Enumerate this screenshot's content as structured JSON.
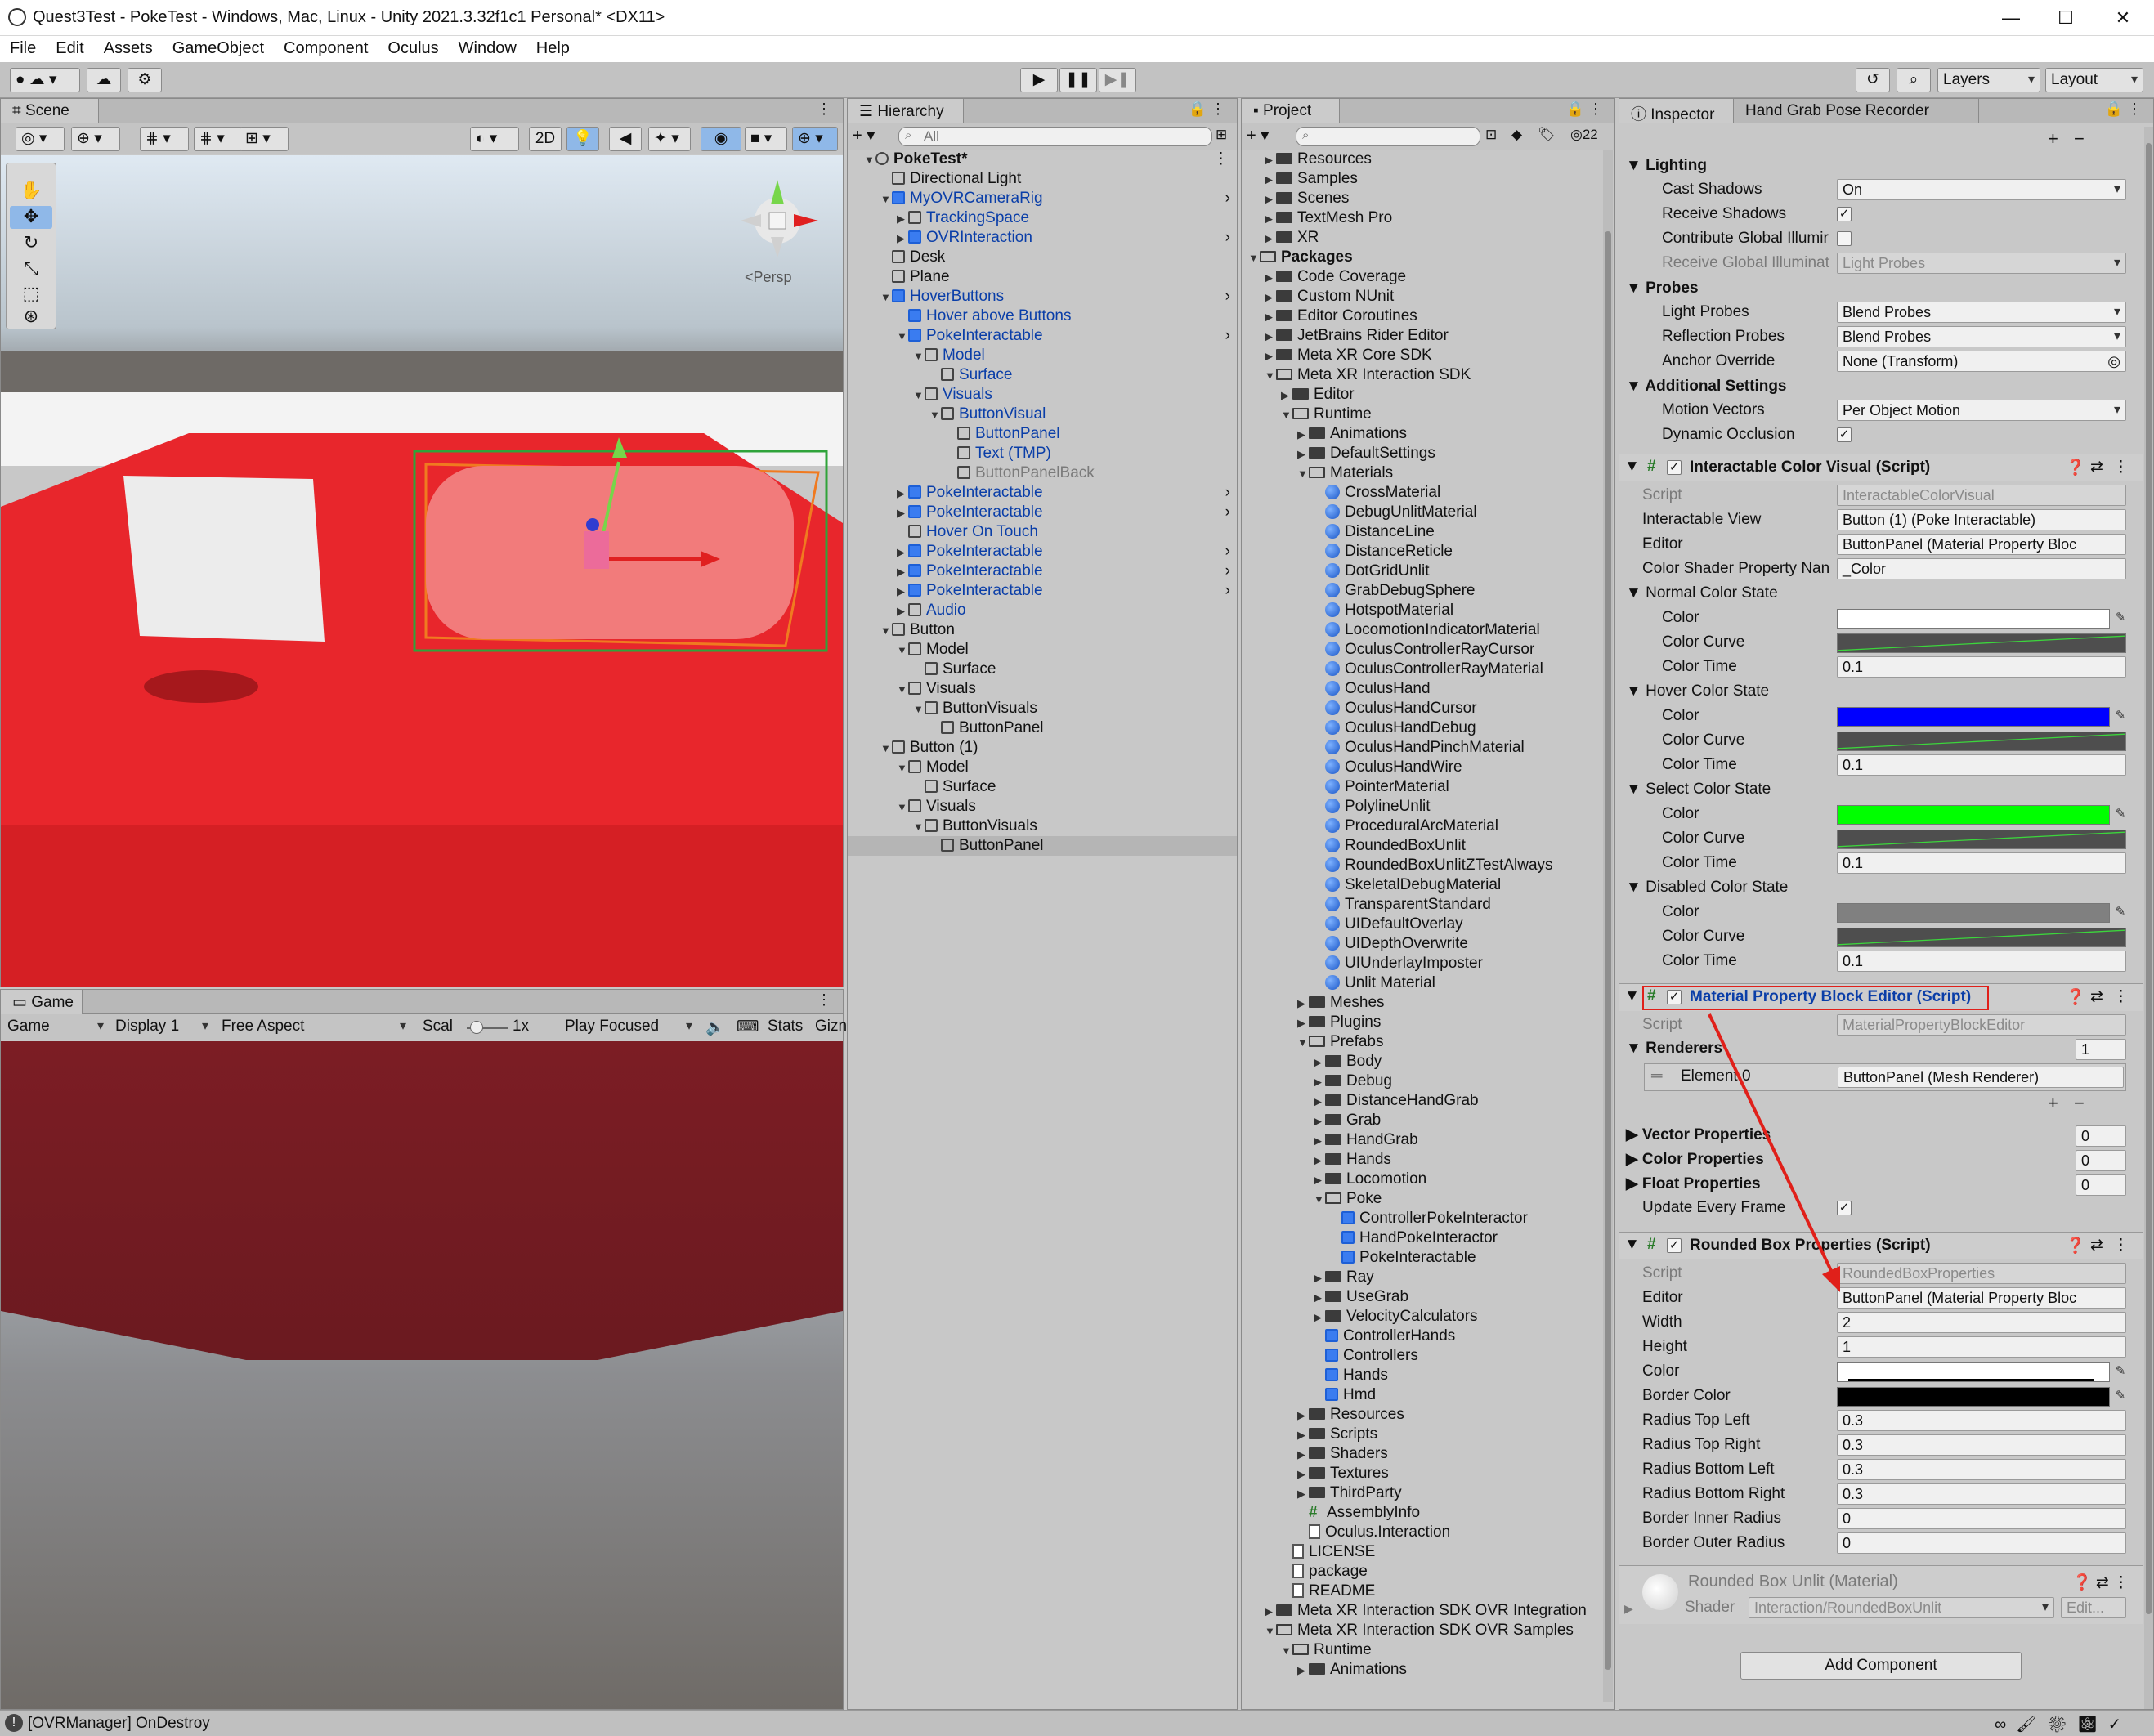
{
  "window": {
    "title": "Quest3Test - PokeTest - Windows, Mac, Linux - Unity 2021.3.32f1c1 Personal* <DX11>",
    "controls": {
      "minimize": "—",
      "maximize": "☐",
      "close": "✕"
    }
  },
  "menu": [
    "File",
    "Edit",
    "Assets",
    "GameObject",
    "Component",
    "Oculus",
    "Window",
    "Help"
  ],
  "toolbar": {
    "play": "▶",
    "pause": "❚❚",
    "step": "▶❚",
    "layers_label": "Layers",
    "layout_label": "Layout"
  },
  "scene": {
    "tab_label": "Scene",
    "persp_label": "<Persp",
    "mode_2d": "2D"
  },
  "game": {
    "tab_label": "Game",
    "display_select": "Game",
    "display": "Display 1",
    "aspect": "Free Aspect",
    "scale_label": "Scal",
    "scale_value": "1x",
    "play_focused": "Play Focused",
    "stats": "Stats",
    "gizmos": "Gizn"
  },
  "hierarchy": {
    "tab_label": "Hierarchy",
    "search_placeholder": "All",
    "items": [
      {
        "label": "PokeTest*",
        "depth": 0,
        "kind": "scene",
        "bold": true,
        "open": true
      },
      {
        "label": "Directional Light",
        "depth": 1,
        "kind": "cube"
      },
      {
        "label": "MyOVRCameraRig",
        "depth": 1,
        "kind": "cubeb",
        "blue": true,
        "open": true,
        "arrow": true
      },
      {
        "label": "TrackingSpace",
        "depth": 2,
        "kind": "cube",
        "blue": true,
        "closed": true
      },
      {
        "label": "OVRInteraction",
        "depth": 2,
        "kind": "cubeb",
        "blue": true,
        "closed": true,
        "arrow": true
      },
      {
        "label": "Desk",
        "depth": 1,
        "kind": "cube"
      },
      {
        "label": "Plane",
        "depth": 1,
        "kind": "cube"
      },
      {
        "label": "HoverButtons",
        "depth": 1,
        "kind": "cubeb",
        "blue": true,
        "open": true,
        "arrow": true
      },
      {
        "label": "Hover above Buttons",
        "depth": 2,
        "kind": "cubeb",
        "blue": true
      },
      {
        "label": "PokeInteractable",
        "depth": 2,
        "kind": "cubeb",
        "blue": true,
        "open": true,
        "arrow": true
      },
      {
        "label": "Model",
        "depth": 3,
        "kind": "cube",
        "blue": true,
        "open": true
      },
      {
        "label": "Surface",
        "depth": 4,
        "kind": "cube",
        "blue": true
      },
      {
        "label": "Visuals",
        "depth": 3,
        "kind": "cube",
        "blue": true,
        "open": true
      },
      {
        "label": "ButtonVisual",
        "depth": 4,
        "kind": "cube",
        "blue": true,
        "open": true
      },
      {
        "label": "ButtonPanel",
        "depth": 5,
        "kind": "cube",
        "blue": true
      },
      {
        "label": "Text (TMP)",
        "depth": 5,
        "kind": "cube",
        "blue": true
      },
      {
        "label": "ButtonPanelBack",
        "depth": 5,
        "kind": "cube",
        "gray": true
      },
      {
        "label": "PokeInteractable",
        "depth": 2,
        "kind": "cubeb",
        "blue": true,
        "closed": true,
        "arrow": true
      },
      {
        "label": "PokeInteractable",
        "depth": 2,
        "kind": "cubeb",
        "blue": true,
        "closed": true,
        "arrow": true
      },
      {
        "label": "Hover On Touch",
        "depth": 2,
        "kind": "cube",
        "blue": true
      },
      {
        "label": "PokeInteractable",
        "depth": 2,
        "kind": "cubeb",
        "blue": true,
        "closed": true,
        "arrow": true
      },
      {
        "label": "PokeInteractable",
        "depth": 2,
        "kind": "cubeb",
        "blue": true,
        "closed": true,
        "arrow": true
      },
      {
        "label": "PokeInteractable",
        "depth": 2,
        "kind": "cubeb",
        "blue": true,
        "closed": true,
        "arrow": true
      },
      {
        "label": "Audio",
        "depth": 2,
        "kind": "cube",
        "blue": true,
        "closed": true
      },
      {
        "label": "Button",
        "depth": 1,
        "kind": "cube",
        "open": true
      },
      {
        "label": "Model",
        "depth": 2,
        "kind": "cube",
        "open": true
      },
      {
        "label": "Surface",
        "depth": 3,
        "kind": "cube"
      },
      {
        "label": "Visuals",
        "depth": 2,
        "kind": "cube",
        "open": true
      },
      {
        "label": "ButtonVisuals",
        "depth": 3,
        "kind": "cube",
        "open": true
      },
      {
        "label": "ButtonPanel",
        "depth": 4,
        "kind": "cube"
      },
      {
        "label": "Button (1)",
        "depth": 1,
        "kind": "cube",
        "open": true
      },
      {
        "label": "Model",
        "depth": 2,
        "kind": "cube",
        "open": true
      },
      {
        "label": "Surface",
        "depth": 3,
        "kind": "cube"
      },
      {
        "label": "Visuals",
        "depth": 2,
        "kind": "cube",
        "open": true
      },
      {
        "label": "ButtonVisuals",
        "depth": 3,
        "kind": "cube",
        "open": true
      },
      {
        "label": "ButtonPanel",
        "depth": 4,
        "kind": "cube",
        "selected": true
      }
    ]
  },
  "project": {
    "tab_label": "Project",
    "hidden_count": "22",
    "items": [
      {
        "label": "Resources",
        "depth": 1,
        "kind": "folder",
        "closed": true
      },
      {
        "label": "Samples",
        "depth": 1,
        "kind": "folder",
        "closed": true
      },
      {
        "label": "Scenes",
        "depth": 1,
        "kind": "folder",
        "closed": true
      },
      {
        "label": "TextMesh Pro",
        "depth": 1,
        "kind": "folder",
        "closed": true
      },
      {
        "label": "XR",
        "depth": 1,
        "kind": "folder",
        "closed": true
      },
      {
        "label": "Packages",
        "depth": 0,
        "kind": "folderopen",
        "open": true,
        "bold": true
      },
      {
        "label": "Code Coverage",
        "depth": 1,
        "kind": "folder",
        "closed": true
      },
      {
        "label": "Custom NUnit",
        "depth": 1,
        "kind": "folder",
        "closed": true
      },
      {
        "label": "Editor Coroutines",
        "depth": 1,
        "kind": "folder",
        "closed": true
      },
      {
        "label": "JetBrains Rider Editor",
        "depth": 1,
        "kind": "folder",
        "closed": true
      },
      {
        "label": "Meta XR Core SDK",
        "depth": 1,
        "kind": "folder",
        "closed": true
      },
      {
        "label": "Meta XR Interaction SDK",
        "depth": 1,
        "kind": "folderopen",
        "open": true
      },
      {
        "label": "Editor",
        "depth": 2,
        "kind": "folder",
        "closed": true
      },
      {
        "label": "Runtime",
        "depth": 2,
        "kind": "folderopen",
        "open": true
      },
      {
        "label": "Animations",
        "depth": 3,
        "kind": "folder",
        "closed": true
      },
      {
        "label": "DefaultSettings",
        "depth": 3,
        "kind": "folder",
        "closed": true
      },
      {
        "label": "Materials",
        "depth": 3,
        "kind": "folderopen",
        "open": true
      },
      {
        "label": "CrossMaterial",
        "depth": 4,
        "kind": "ball"
      },
      {
        "label": "DebugUnlitMaterial",
        "depth": 4,
        "kind": "ball"
      },
      {
        "label": "DistanceLine",
        "depth": 4,
        "kind": "ball"
      },
      {
        "label": "DistanceReticle",
        "depth": 4,
        "kind": "ball"
      },
      {
        "label": "DotGridUnlit",
        "depth": 4,
        "kind": "ball"
      },
      {
        "label": "GrabDebugSphere",
        "depth": 4,
        "kind": "ball"
      },
      {
        "label": "HotspotMaterial",
        "depth": 4,
        "kind": "ball"
      },
      {
        "label": "LocomotionIndicatorMaterial",
        "depth": 4,
        "kind": "ball"
      },
      {
        "label": "OculusControllerRayCursor",
        "depth": 4,
        "kind": "ball"
      },
      {
        "label": "OculusControllerRayMaterial",
        "depth": 4,
        "kind": "ball"
      },
      {
        "label": "OculusHand",
        "depth": 4,
        "kind": "ball"
      },
      {
        "label": "OculusHandCursor",
        "depth": 4,
        "kind": "ball"
      },
      {
        "label": "OculusHandDebug",
        "depth": 4,
        "kind": "ball"
      },
      {
        "label": "OculusHandPinchMaterial",
        "depth": 4,
        "kind": "ball"
      },
      {
        "label": "OculusHandWire",
        "depth": 4,
        "kind": "ball"
      },
      {
        "label": "PointerMaterial",
        "depth": 4,
        "kind": "ball"
      },
      {
        "label": "PolylineUnlit",
        "depth": 4,
        "kind": "ball"
      },
      {
        "label": "ProceduralArcMaterial",
        "depth": 4,
        "kind": "ball"
      },
      {
        "label": "RoundedBoxUnlit",
        "depth": 4,
        "kind": "ball"
      },
      {
        "label": "RoundedBoxUnlitZTestAlways",
        "depth": 4,
        "kind": "ball"
      },
      {
        "label": "SkeletalDebugMaterial",
        "depth": 4,
        "kind": "ball"
      },
      {
        "label": "TransparentStandard",
        "depth": 4,
        "kind": "ball"
      },
      {
        "label": "UIDefaultOverlay",
        "depth": 4,
        "kind": "ball"
      },
      {
        "label": "UIDepthOverwrite",
        "depth": 4,
        "kind": "ball"
      },
      {
        "label": "UIUnderlayImposter",
        "depth": 4,
        "kind": "ball"
      },
      {
        "label": "Unlit Material",
        "depth": 4,
        "kind": "ball"
      },
      {
        "label": "Meshes",
        "depth": 3,
        "kind": "folder",
        "closed": true
      },
      {
        "label": "Plugins",
        "depth": 3,
        "kind": "folder",
        "closed": true
      },
      {
        "label": "Prefabs",
        "depth": 3,
        "kind": "folderopen",
        "open": true
      },
      {
        "label": "Body",
        "depth": 4,
        "kind": "folder",
        "closed": true
      },
      {
        "label": "Debug",
        "depth": 4,
        "kind": "folder",
        "closed": true
      },
      {
        "label": "DistanceHandGrab",
        "depth": 4,
        "kind": "folder",
        "closed": true
      },
      {
        "label": "Grab",
        "depth": 4,
        "kind": "folder",
        "closed": true
      },
      {
        "label": "HandGrab",
        "depth": 4,
        "kind": "folder",
        "closed": true
      },
      {
        "label": "Hands",
        "depth": 4,
        "kind": "folder",
        "closed": true
      },
      {
        "label": "Locomotion",
        "depth": 4,
        "kind": "folder",
        "closed": true
      },
      {
        "label": "Poke",
        "depth": 4,
        "kind": "folderopen",
        "open": true
      },
      {
        "label": "ControllerPokeInteractor",
        "depth": 5,
        "kind": "cubeb"
      },
      {
        "label": "HandPokeInteractor",
        "depth": 5,
        "kind": "cubeb"
      },
      {
        "label": "PokeInteractable",
        "depth": 5,
        "kind": "cubeb"
      },
      {
        "label": "Ray",
        "depth": 4,
        "kind": "folder",
        "closed": true
      },
      {
        "label": "UseGrab",
        "depth": 4,
        "kind": "folder",
        "closed": true
      },
      {
        "label": "VelocityCalculators",
        "depth": 4,
        "kind": "folder",
        "closed": true
      },
      {
        "label": "ControllerHands",
        "depth": 4,
        "kind": "cubeb"
      },
      {
        "label": "Controllers",
        "depth": 4,
        "kind": "cubeb"
      },
      {
        "label": "Hands",
        "depth": 4,
        "kind": "cubeb"
      },
      {
        "label": "Hmd",
        "depth": 4,
        "kind": "cubeb"
      },
      {
        "label": "Resources",
        "depth": 3,
        "kind": "folder",
        "closed": true
      },
      {
        "label": "Scripts",
        "depth": 3,
        "kind": "folder",
        "closed": true
      },
      {
        "label": "Shaders",
        "depth": 3,
        "kind": "folder",
        "closed": true
      },
      {
        "label": "Textures",
        "depth": 3,
        "kind": "folder",
        "closed": true
      },
      {
        "label": "ThirdParty",
        "depth": 3,
        "kind": "folder",
        "closed": true
      },
      {
        "label": "AssemblyInfo",
        "depth": 3,
        "kind": "hash"
      },
      {
        "label": "Oculus.Interaction",
        "depth": 3,
        "kind": "doc"
      },
      {
        "label": "LICENSE",
        "depth": 2,
        "kind": "doc"
      },
      {
        "label": "package",
        "depth": 2,
        "kind": "doc"
      },
      {
        "label": "README",
        "depth": 2,
        "kind": "doc"
      },
      {
        "label": "Meta XR Interaction SDK OVR Integration",
        "depth": 1,
        "kind": "folder",
        "closed": true
      },
      {
        "label": "Meta XR Interaction SDK OVR Samples",
        "depth": 1,
        "kind": "folderopen",
        "open": true
      },
      {
        "label": "Runtime",
        "depth": 2,
        "kind": "folderopen",
        "open": true
      },
      {
        "label": "Animations",
        "depth": 3,
        "kind": "folder",
        "closed": true
      }
    ]
  },
  "inspector": {
    "tab_label": "Inspector",
    "tab2_label": "Hand Grab Pose Recorder",
    "lighting": {
      "header": "Lighting",
      "cast_shadows_label": "Cast Shadows",
      "cast_shadows_value": "On",
      "receive_shadows_label": "Receive Shadows",
      "contribute_gi_label": "Contribute Global Illumir",
      "receive_gi_label": "Receive Global Illuminat",
      "receive_gi_value": "Light Probes"
    },
    "probes": {
      "header": "Probes",
      "light_probes_label": "Light Probes",
      "light_probes_value": "Blend Probes",
      "reflection_probes_label": "Reflection Probes",
      "reflection_probes_value": "Blend Probes",
      "anchor_label": "Anchor Override",
      "anchor_value": "None (Transform)"
    },
    "additional": {
      "header": "Additional Settings",
      "motion_vectors_label": "Motion Vectors",
      "motion_vectors_value": "Per Object Motion",
      "dynamic_occlusion_label": "Dynamic Occlusion"
    },
    "color_visual": {
      "title": "Interactable Color Visual (Script)",
      "script_label": "Script",
      "script_value": "InteractableColorVisual",
      "view_label": "Interactable View",
      "view_value": "Button (1) (Poke Interactable)",
      "editor_label": "Editor",
      "editor_value": "ButtonPanel (Material Property Bloc",
      "shader_prop_label": "Color Shader Property Nan",
      "shader_prop_value": "_Color",
      "states": [
        {
          "name": "Normal Color State",
          "color": "#ffffff",
          "time": "0.1"
        },
        {
          "name": "Hover Color State",
          "color": "#0000ff",
          "time": "0.1"
        },
        {
          "name": "Select Color State",
          "color": "#00ff00",
          "time": "0.1"
        },
        {
          "name": "Disabled Color State",
          "color": "#808080",
          "time": "0.1"
        }
      ],
      "color_label": "Color",
      "curve_label": "Color Curve",
      "time_label": "Color Time"
    },
    "mpb_editor": {
      "title": "Material Property Block Editor (Script)",
      "script_label": "Script",
      "script_value": "MaterialPropertyBlockEditor",
      "renderers_label": "Renderers",
      "renderers_count": "1",
      "element_label": "Element 0",
      "element_value": "ButtonPanel (Mesh Renderer)",
      "vector_label": "Vector Properties",
      "vector_count": "0",
      "color_label": "Color Properties",
      "color_count": "0",
      "float_label": "Float Properties",
      "float_count": "0",
      "update_label": "Update Every Frame"
    },
    "rounded_box": {
      "title": "Rounded Box Properties (Script)",
      "script_label": "Script",
      "script_value": "RoundedBoxProperties",
      "editor_label": "Editor",
      "editor_value": "ButtonPanel (Material Property Bloc",
      "width_label": "Width",
      "width_value": "2",
      "height_label": "Height",
      "height_value": "1",
      "color_label": "Color",
      "color_value": "#ffffff",
      "border_color_label": "Border Color",
      "border_color_value": "#000000",
      "rtl_label": "Radius Top Left",
      "rtl_value": "0.3",
      "rtr_label": "Radius Top Right",
      "rtr_value": "0.3",
      "rbl_label": "Radius Bottom Left",
      "rbl_value": "0.3",
      "rbr_label": "Radius Bottom Right",
      "rbr_value": "0.3",
      "bir_label": "Border Inner Radius",
      "bir_value": "0",
      "bor_label": "Border Outer Radius",
      "bor_value": "0"
    },
    "material": {
      "title": "Rounded Box Unlit (Material)",
      "shader_label": "Shader",
      "shader_value": "Interaction/RoundedBoxUnlit",
      "edit_label": "Edit..."
    },
    "add_component": "Add Component"
  },
  "status": {
    "message": "[OVRManager] OnDestroy"
  },
  "colors": {
    "highlight_box": "#e0201a",
    "annotation_arrow": "#e0201a",
    "scene_red": "#e8262c"
  }
}
